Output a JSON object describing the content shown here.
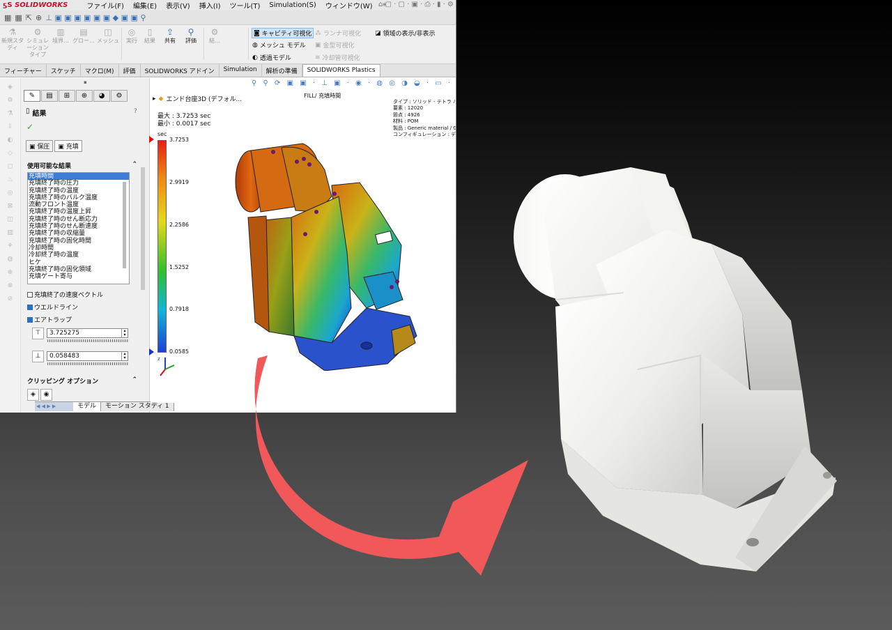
{
  "app": {
    "logo": "SOLIDWORKS",
    "logo_prefix": "DS"
  },
  "menu": [
    "ファイル(F)",
    "編集(E)",
    "表示(V)",
    "挿入(I)",
    "ツール(T)",
    "Simulation(S)",
    "ウィンドウ(W)"
  ],
  "ribbon": {
    "buttons": [
      "新規スタディ",
      "シミュレーションタイプ",
      "境界...",
      "グロー...",
      "メッシュ",
      "実行",
      "結果",
      "共有",
      "評価",
      "結..."
    ],
    "options": {
      "cavity": "キャビティ可視化",
      "runner": "ランナ可視化",
      "toggle_region": "領域の表示/非表示",
      "mesh_model": "メッシュ モデル",
      "mold": "金型可視化",
      "transparent": "透過モデル",
      "cooling": "冷却管可視化"
    }
  },
  "tabs": [
    "フィーチャー",
    "スケッチ",
    "マクロ(M)",
    "評価",
    "SOLIDWORKS アドイン",
    "Simulation",
    "解析の準備",
    "SOLIDWORKS Plastics"
  ],
  "active_tab": "SOLIDWORKS Plastics",
  "panel": {
    "title": "結果",
    "subtabs": [
      "保圧",
      "充填"
    ],
    "available_results_label": "使用可能な結果",
    "results": [
      "充填時間",
      "充填終了時の圧力",
      "充填終了時の温度",
      "充填終了時のバルク温度",
      "流動フロント温度",
      "充填終了時の温度上昇",
      "充填終了時のせん断応力",
      "充填終了時のせん断速度",
      "充填終了時の収縮量",
      "充填終了時の固化時間",
      "冷却時間",
      "冷却終了時の温度",
      "ヒケ",
      "充填終了時の固化領域",
      "充填ゲート寄与"
    ],
    "selected_result": "充填時間",
    "velocity_vector": {
      "label": "充填終了の速度ベクトル",
      "checked": false
    },
    "weldlines": {
      "label": "ウエルドライン",
      "checked": true
    },
    "airtraps": {
      "label": "エアトラップ",
      "checked": true
    },
    "max_value": "3.725275",
    "min_value": "0.058483",
    "clipping_label": "クリッピング オプション"
  },
  "bottom_tabs": [
    "モデル",
    "モーション スタディ 1"
  ],
  "view": {
    "tree_item": "エンド台座3D (デフォル...",
    "max_label": "最大 : 3.7253 sec",
    "min_label": "最小 : 0.0017 sec",
    "plot_title": "FILL/ 充填時間",
    "info": [
      "タイプ : ソリッド - テトラ ハイブ",
      "要素 : 12020",
      "節点 : 4926",
      "材料 : POM",
      "製品 : Generic material / Ge",
      "コンフィギュレーション : デフォル"
    ],
    "unit": "sec",
    "scale": [
      "3.7253",
      "2.9919",
      "2.2586",
      "1.5252",
      "0.7918",
      "0.0585"
    ]
  },
  "colors": {
    "arrow": "#f0585a",
    "logo": "#c8102e",
    "selection": "#3d7bd6"
  }
}
